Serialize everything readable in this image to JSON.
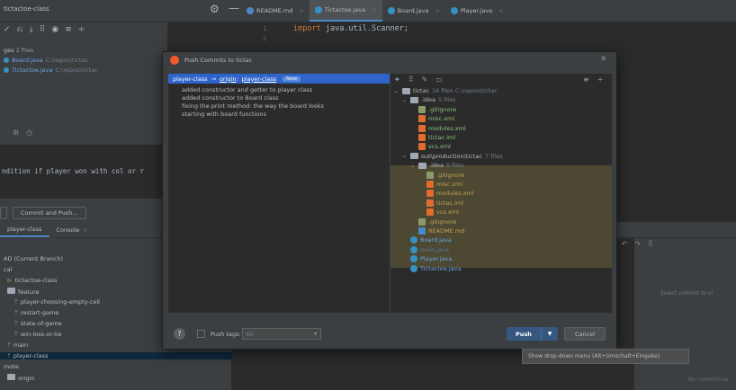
{
  "colors": {
    "accent": "#2f65ca",
    "file_java": "#6aa7e7",
    "file_xml": "#e06c2e",
    "file_git": "#8c9a6a",
    "highlight": "#524d33"
  },
  "window": {
    "project_title": "tictactoe-class",
    "settings_icon": "gear-icon",
    "minimize_icon": "minus-icon"
  },
  "editor_tabs": [
    {
      "label": "README.md",
      "icon": "markdown-icon"
    },
    {
      "label": "Tictactoe.java",
      "icon": "java-class-icon",
      "active": true
    },
    {
      "label": "Board.java",
      "icon": "java-class-icon"
    },
    {
      "label": "Player.java",
      "icon": "java-class-icon"
    }
  ],
  "editor": {
    "lines": [
      {
        "num": "1",
        "keyword": "import",
        "rest": " java.util.Scanner;"
      },
      {
        "num": "2"
      }
    ]
  },
  "commit_panel": {
    "changes_label": "ges",
    "changes_count": "2 files",
    "files": [
      {
        "name": "Board.java",
        "path": "C:\\repos\\tictac"
      },
      {
        "name": "Tictactoe.java",
        "path": "C:\\repos\\tictac"
      }
    ],
    "commit_message": "ndition if player won with col or r",
    "commit_and_push_label": "Commit and Push..."
  },
  "git_panel": {
    "tabs": [
      {
        "label": "player-class"
      },
      {
        "label": "Console"
      }
    ],
    "branches": [
      {
        "label": "AD (Current Branch)"
      },
      {
        "label": "cal"
      },
      {
        "label": "tictactoe-class",
        "tag": "⊳"
      },
      {
        "label": "feature",
        "folder": true
      },
      {
        "label": "player-choosing-empty-cell",
        "tag": "ᛘ"
      },
      {
        "label": "restart-game",
        "tag": "ᛘ"
      },
      {
        "label": "state-of-game",
        "tag": "ᛘ"
      },
      {
        "label": "win-loss-or-tie",
        "tag": "ᛘ"
      },
      {
        "label": "main",
        "tag": "ᛘ"
      },
      {
        "label": "player-class",
        "tag": "ᛘ",
        "selected": true
      },
      {
        "label": "mote"
      },
      {
        "label": "origin",
        "folder": true
      }
    ],
    "select_commit_text": "Select commit to vi",
    "no_commits_text": "No commits se"
  },
  "dialog": {
    "title": "Push Commits to tictac",
    "push_target": {
      "branch": "player-class",
      "arrow": "→",
      "remote": "origin",
      "sep": ":",
      "remote_branch": "player-class",
      "new_badge": "New"
    },
    "commits": [
      "added constructor and getter to player class",
      "added constructor to Board class",
      "fixing the print method: the way the board looks",
      "starting with board functions"
    ],
    "tree": [
      {
        "label": "tictac",
        "meta": "16 files  C:\\repos\\tictac",
        "depth": 0,
        "type": "folder",
        "expanded": true
      },
      {
        "label": ".idea",
        "meta": "5 files",
        "depth": 1,
        "type": "folder",
        "expanded": true
      },
      {
        "label": ".gitignore",
        "depth": 2,
        "type": "git"
      },
      {
        "label": "misc.xml",
        "depth": 2,
        "type": "xml"
      },
      {
        "label": "modules.xml",
        "depth": 2,
        "type": "xml"
      },
      {
        "label": "tictac.iml",
        "depth": 2,
        "type": "iml"
      },
      {
        "label": "vcs.xml",
        "depth": 2,
        "type": "xml"
      },
      {
        "label": "out\\production\\tictac",
        "meta": "7 files",
        "depth": 1,
        "type": "folder",
        "expanded": true,
        "hl": true
      },
      {
        "label": ".idea",
        "meta": "5 files",
        "depth": 2,
        "type": "folder",
        "expanded": true,
        "hl": true
      },
      {
        "label": ".gitignore",
        "depth": 3,
        "type": "git",
        "hl": true
      },
      {
        "label": "misc.xml",
        "depth": 3,
        "type": "xml",
        "hl": true
      },
      {
        "label": "modules.xml",
        "depth": 3,
        "type": "xml",
        "hl": true
      },
      {
        "label": "tictac.iml",
        "depth": 3,
        "type": "iml",
        "hl": true
      },
      {
        "label": "vcs.xml",
        "depth": 3,
        "type": "xml",
        "hl": true
      },
      {
        "label": ".gitignore",
        "depth": 2,
        "type": "git",
        "hl": true
      },
      {
        "label": "README.md",
        "depth": 2,
        "type": "md",
        "hl": true
      },
      {
        "label": "Board.java",
        "depth": 1,
        "type": "java"
      },
      {
        "label": "main.java",
        "depth": 1,
        "type": "java-dim"
      },
      {
        "label": "Player.java",
        "depth": 1,
        "type": "java"
      },
      {
        "label": "Tictactoe.java",
        "depth": 1,
        "type": "java"
      }
    ],
    "push_tags_label": "Push tags:",
    "tags_select_value": "All",
    "push_label": "Push",
    "cancel_label": "Cancel",
    "help_label": "?"
  },
  "tooltip": {
    "text": "Show drop-down menu (Alt+Umschalt+Eingabe)"
  }
}
